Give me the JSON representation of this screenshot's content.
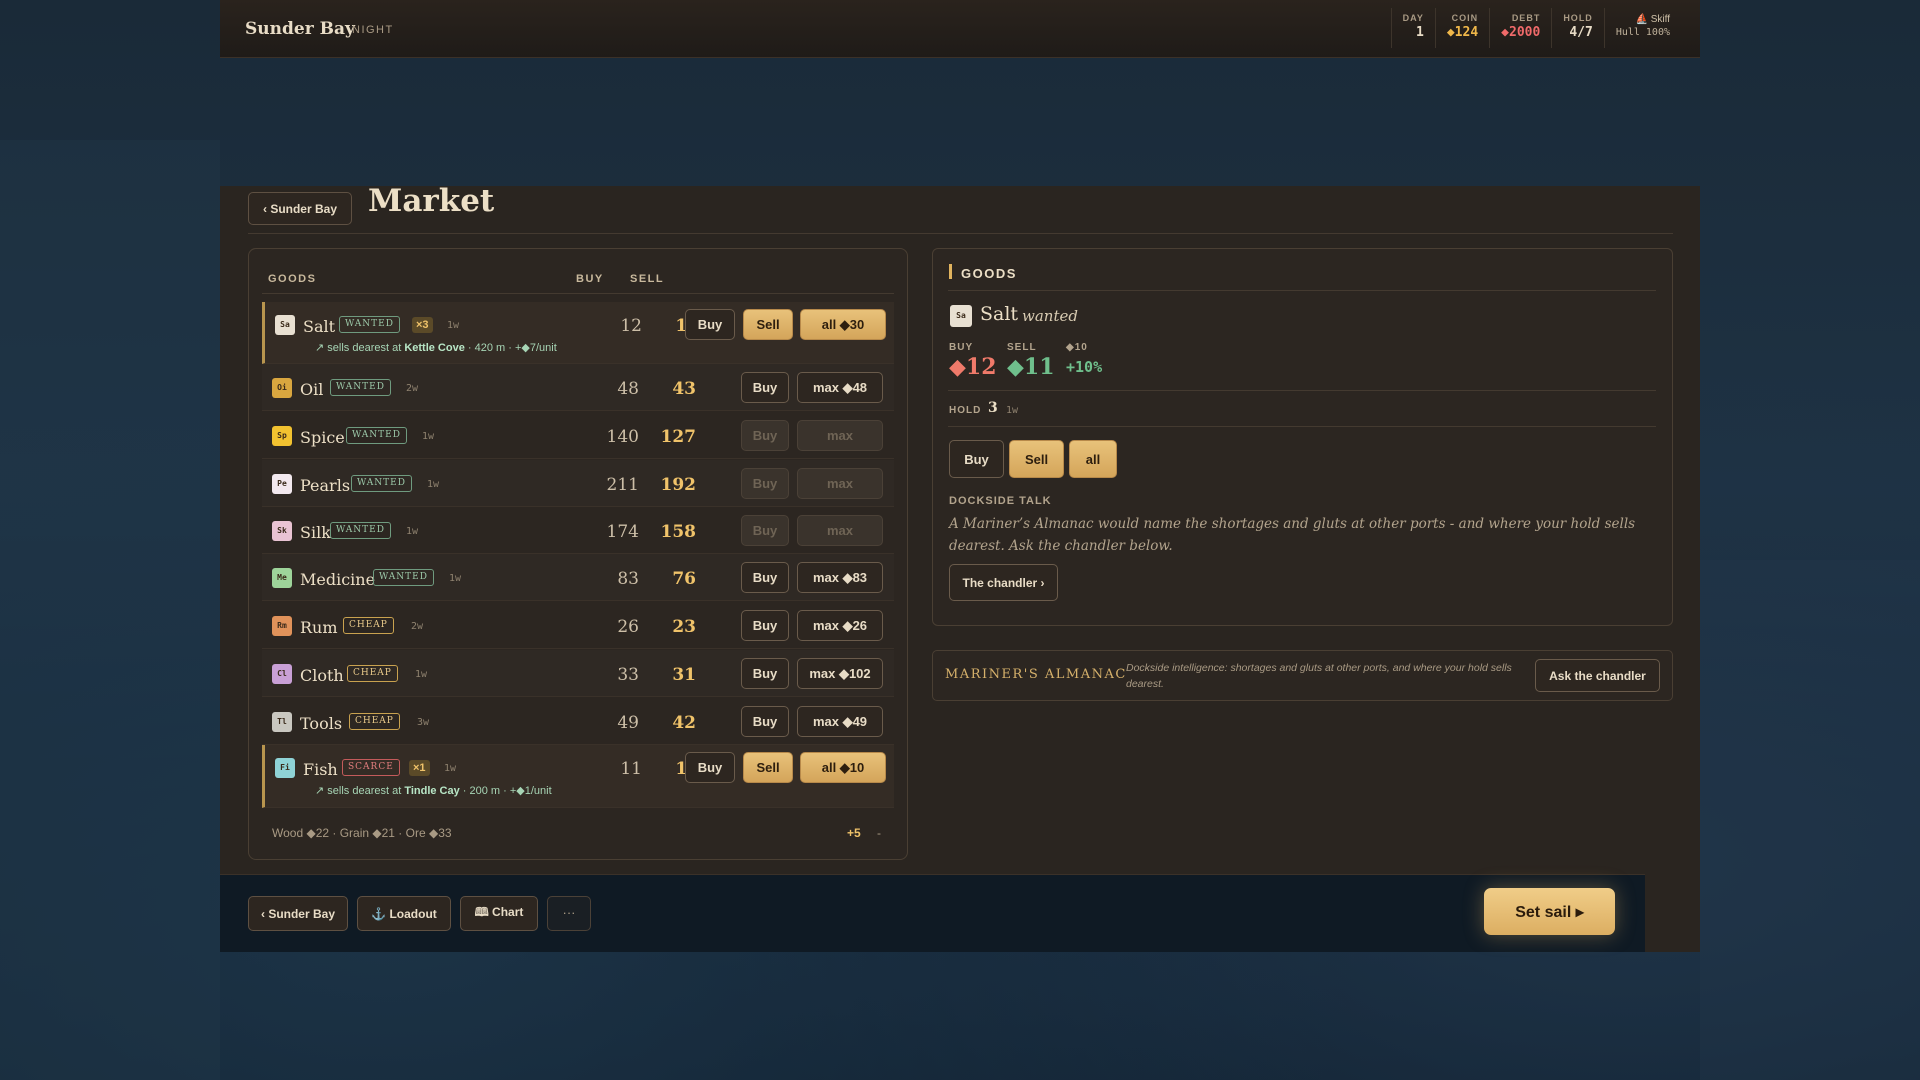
{
  "hud": {
    "port": "Sunder Bay",
    "time": "NIGHT",
    "stats": [
      {
        "label": "DAY",
        "value": "1",
        "kind": "plain"
      },
      {
        "label": "COIN",
        "value": "◆124",
        "kind": "coin"
      },
      {
        "label": "DEBT",
        "value": "◆2000",
        "kind": "debt"
      },
      {
        "label": "HOLD",
        "value": "4/7",
        "kind": "plain"
      }
    ],
    "ship": {
      "name": "⛵ Skiff",
      "hull": "Hull 100%"
    }
  },
  "header": {
    "back_label": "‹ Sunder Bay",
    "title": "Market"
  },
  "table": {
    "headers": {
      "goods": "GOODS",
      "buy": "BUY",
      "sell": "SELL"
    },
    "rows": [
      {
        "code": "Sa",
        "name": "Salt",
        "tag": "WANTED",
        "tagType": "wanted",
        "mult": "×3",
        "weight": "1w",
        "buy": "12",
        "sell": "11",
        "buyLabel": "Buy",
        "sellLabel": "Sell",
        "actionLabel": "all ◆30",
        "active": true,
        "hintPre": "↗ sells dearest at ",
        "hintPort": "Kettle Cove",
        "hintPost": " · 420 m · +◆7/unit",
        "color": "#e8e0d2",
        "buyDisabled": false,
        "actionDisabled": false
      },
      {
        "code": "Oi",
        "name": "Oil",
        "tag": "WANTED",
        "tagType": "wanted",
        "mult": "",
        "weight": "2w",
        "buy": "48",
        "sell": "43",
        "buyLabel": "Buy",
        "actionLabel": "max ◆48",
        "active": false,
        "color": "#d9a63f",
        "buyDisabled": false,
        "actionDisabled": false
      },
      {
        "code": "Sp",
        "name": "Spice",
        "tag": "WANTED",
        "tagType": "wanted",
        "mult": "",
        "weight": "1w",
        "buy": "140",
        "sell": "127",
        "buyLabel": "Buy",
        "actionLabel": "max",
        "active": false,
        "color": "#f2c230",
        "buyDisabled": true,
        "actionDisabled": true
      },
      {
        "code": "Pe",
        "name": "Pearls",
        "tag": "WANTED",
        "tagType": "wanted",
        "mult": "",
        "weight": "1w",
        "buy": "211",
        "sell": "192",
        "buyLabel": "Buy",
        "actionLabel": "max",
        "active": false,
        "color": "#f3e9ef",
        "buyDisabled": true,
        "actionDisabled": true
      },
      {
        "code": "Sk",
        "name": "Silk",
        "tag": "WANTED",
        "tagType": "wanted",
        "mult": "",
        "weight": "1w",
        "buy": "174",
        "sell": "158",
        "buyLabel": "Buy",
        "actionLabel": "max",
        "active": false,
        "color": "#e9c3d3",
        "buyDisabled": true,
        "actionDisabled": true
      },
      {
        "code": "Me",
        "name": "Medicine",
        "tag": "WANTED",
        "tagType": "wanted",
        "mult": "",
        "weight": "1w",
        "buy": "83",
        "sell": "76",
        "buyLabel": "Buy",
        "actionLabel": "max ◆83",
        "active": false,
        "color": "#9ed49a",
        "buyDisabled": false,
        "actionDisabled": false
      },
      {
        "code": "Rm",
        "name": "Rum",
        "tag": "CHEAP",
        "tagType": "cheap",
        "mult": "",
        "weight": "2w",
        "buy": "26",
        "sell": "23",
        "buyLabel": "Buy",
        "actionLabel": "max ◆26",
        "active": false,
        "color": "#e0925a",
        "buyDisabled": false,
        "actionDisabled": false
      },
      {
        "code": "Cl",
        "name": "Cloth",
        "tag": "CHEAP",
        "tagType": "cheap",
        "mult": "",
        "weight": "1w",
        "buy": "33",
        "sell": "31",
        "buyLabel": "Buy",
        "actionLabel": "max ◆102",
        "active": false,
        "color": "#c9a0d6",
        "buyDisabled": false,
        "actionDisabled": false
      },
      {
        "code": "Tl",
        "name": "Tools",
        "tag": "CHEAP",
        "tagType": "cheap",
        "mult": "",
        "weight": "3w",
        "buy": "49",
        "sell": "42",
        "buyLabel": "Buy",
        "actionLabel": "max ◆49",
        "active": false,
        "color": "#c9c7c0",
        "buyDisabled": false,
        "actionDisabled": false
      },
      {
        "code": "Fi",
        "name": "Fish",
        "tag": "SCARCE",
        "tagType": "scarce",
        "mult": "×1",
        "weight": "1w",
        "buy": "11",
        "sell": "10",
        "buyLabel": "Buy",
        "sellLabel": "Sell",
        "actionLabel": "all ◆10",
        "active": true,
        "hintPre": "↗ sells dearest at ",
        "hintPort": "Tindle Cay",
        "hintPost": " · 200 m · +◆1/unit",
        "color": "#8fd3d6",
        "buyDisabled": false,
        "actionDisabled": false
      }
    ],
    "footer": {
      "other": "Wood ◆22 · Grain ◆21 · Ore ◆33",
      "more": "+5",
      "collapse": "-"
    }
  },
  "detail": {
    "section": "GOODS",
    "code": "Sa",
    "name": "Salt",
    "status": "wanted",
    "buy_label": "BUY",
    "buy_value": "◆12",
    "sell_label": "SELL",
    "sell_value": "◆11",
    "ref_label": "◆10",
    "ref_value": "+10%",
    "hold_label": "HOLD",
    "hold_value": "3",
    "hold_weight": "1w",
    "btn_buy": "Buy",
    "btn_sell": "Sell",
    "btn_all": "all",
    "talk_label": "DOCKSIDE TALK",
    "talk_text": "A Mariner’s Almanac would name the shortages and gluts at other ports - and where your hold sells dearest. Ask the chandler below.",
    "chandler_btn": "The chandler ›"
  },
  "almanac": {
    "title": "MARINER'S ALMANAC",
    "desc": "Dockside intelligence: shortages and gluts at other ports, and where your hold sells dearest.",
    "button": "Ask the chandler"
  },
  "bottom": {
    "back": "‹ Sunder Bay",
    "loadout": "⚓ Loadout",
    "chart": "🕮 Chart",
    "more": "···",
    "sail": "Set sail ▸"
  },
  "colors": {
    "accent": "#e0b35e",
    "buy_price": "#f07a6a",
    "sell_price": "#6fbf8c",
    "panel": "#2a2520"
  }
}
